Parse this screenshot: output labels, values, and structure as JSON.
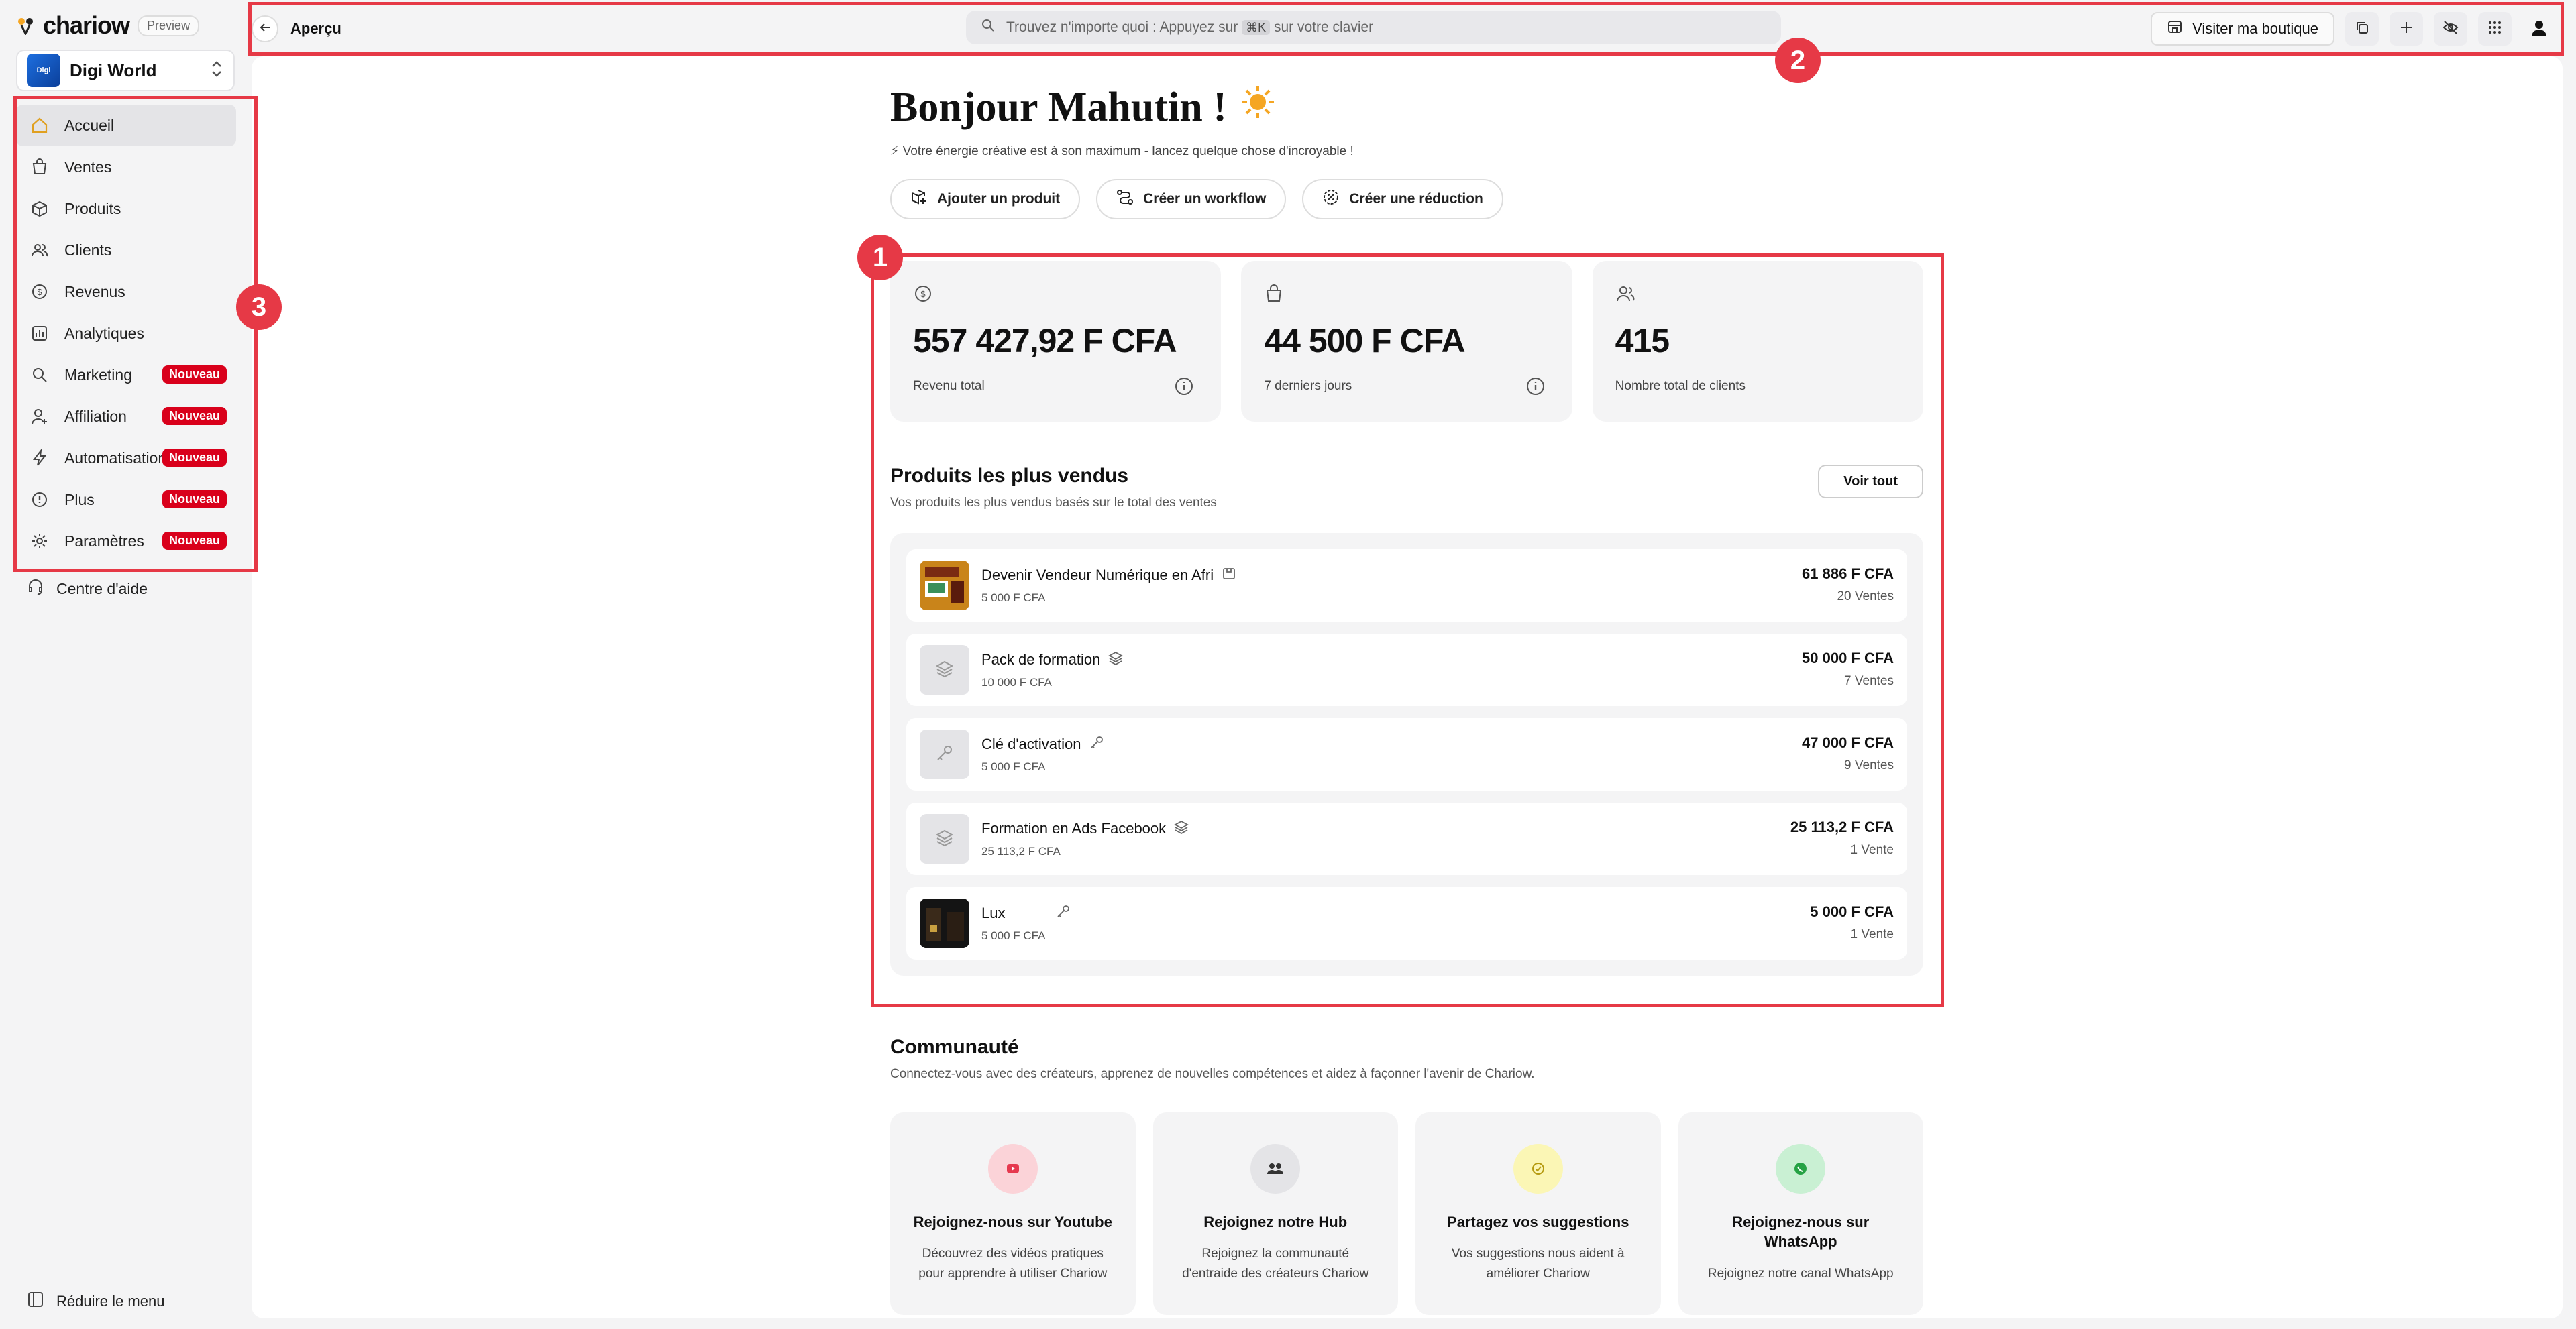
{
  "brand": {
    "name": "chariow",
    "tag": "Preview"
  },
  "store": {
    "name": "Digi World",
    "avatar_text": "Digi"
  },
  "nav": [
    {
      "label": "Accueil",
      "icon": "home-icon",
      "active": true,
      "badge": ""
    },
    {
      "label": "Ventes",
      "icon": "shopping-bag-icon",
      "badge": ""
    },
    {
      "label": "Produits",
      "icon": "box-icon",
      "badge": ""
    },
    {
      "label": "Clients",
      "icon": "users-icon",
      "badge": ""
    },
    {
      "label": "Revenus",
      "icon": "coin-icon",
      "badge": ""
    },
    {
      "label": "Analytiques",
      "icon": "chart-icon",
      "badge": ""
    },
    {
      "label": "Marketing",
      "icon": "megaphone-icon",
      "badge": "Nouveau"
    },
    {
      "label": "Affiliation",
      "icon": "user-plus-icon",
      "badge": "Nouveau"
    },
    {
      "label": "Automatisation",
      "icon": "bolt-icon",
      "badge": "Nouveau"
    },
    {
      "label": "Plus",
      "icon": "info-icon",
      "badge": "Nouveau"
    },
    {
      "label": "Paramètres",
      "icon": "gear-icon",
      "badge": "Nouveau"
    }
  ],
  "help": {
    "label": "Centre d'aide"
  },
  "collapse": {
    "label": "Réduire le menu"
  },
  "topbar": {
    "page": "Aperçu",
    "search_prefix": "Trouvez n'importe quoi : Appuyez sur",
    "search_kbd": "⌘K",
    "search_suffix": "sur votre clavier",
    "visit": "Visiter ma boutique"
  },
  "greeting": {
    "title": "Bonjour Mahutin !",
    "subtitle": "⚡ Votre énergie créative est à son maximum - lancez quelque chose d'incroyable !"
  },
  "quick_actions": [
    "Ajouter un produit",
    "Créer un workflow",
    "Créer une réduction"
  ],
  "stats": [
    {
      "value": "557 427,92 F CFA",
      "label": "Revenu total"
    },
    {
      "value": "44 500 F CFA",
      "label": "7 derniers jours"
    },
    {
      "value": "415",
      "label": "Nombre total de clients"
    }
  ],
  "top_products": {
    "title": "Produits les plus vendus",
    "subtitle": "Vos produits les plus vendus basés sur le total des ventes",
    "see_all": "Voir tout",
    "items": [
      {
        "name": "Devenir Vendeur Numérique en Afri",
        "price": "5 000 F CFA",
        "total": "61 886 F CFA",
        "sales": "20 Ventes"
      },
      {
        "name": "Pack de formation",
        "price": "10 000 F CFA",
        "total": "50 000 F CFA",
        "sales": "7 Ventes"
      },
      {
        "name": "Clé d'activation",
        "price": "5 000 F CFA",
        "total": "47 000 F CFA",
        "sales": "9 Ventes"
      },
      {
        "name": "Formation en Ads Facebook",
        "price": "25 113,2 F CFA",
        "total": "25 113,2 F CFA",
        "sales": "1 Vente"
      },
      {
        "name": "Lux",
        "price": "5 000 F CFA",
        "total": "5 000 F CFA",
        "sales": "1 Vente"
      }
    ]
  },
  "community": {
    "title": "Communauté",
    "subtitle": "Connectez-vous avec des créateurs, apprenez de nouvelles compétences et aidez à façonner l'avenir de Chariow.",
    "cards": [
      {
        "title": "Rejoignez-nous sur Youtube",
        "desc": "Découvrez des vidéos pratiques pour apprendre à utiliser Chariow"
      },
      {
        "title": "Rejoignez notre Hub",
        "desc": "Rejoignez la communauté d'entraide des créateurs Chariow"
      },
      {
        "title": "Partagez vos suggestions",
        "desc": "Vos suggestions nous aident à améliorer Chariow"
      },
      {
        "title": "Rejoignez-nous sur WhatsApp",
        "desc": "Rejoignez notre canal WhatsApp"
      }
    ]
  },
  "annotations": [
    "1",
    "2",
    "3"
  ],
  "colors": {
    "accent": "#e63946",
    "badge": "#d9001b",
    "active_nav": "#e4e4e7"
  }
}
